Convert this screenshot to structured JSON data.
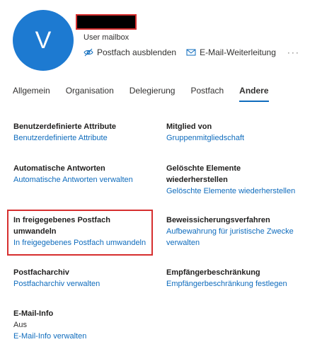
{
  "header": {
    "avatar_letter": "V",
    "subtitle": "User mailbox",
    "actions": [
      {
        "label": "Postfach ausblenden",
        "icon": "hide-mailbox-icon"
      },
      {
        "label": "E-Mail-Weiterleitung",
        "icon": "mail-forward-icon"
      }
    ],
    "more_label": "···"
  },
  "tabs": [
    {
      "label": "Allgemein",
      "active": false
    },
    {
      "label": "Organisation",
      "active": false
    },
    {
      "label": "Delegierung",
      "active": false
    },
    {
      "label": "Postfach",
      "active": false
    },
    {
      "label": "Andere",
      "active": true
    }
  ],
  "sections": {
    "custom_attributes": {
      "title": "Benutzerdefinierte Attribute",
      "link": "Benutzerdefinierte Attribute"
    },
    "member_of": {
      "title": "Mitglied von",
      "link": "Gruppenmitgliedschaft"
    },
    "auto_replies": {
      "title": "Automatische Antworten",
      "link": "Automatische Antworten verwalten"
    },
    "deleted_items": {
      "title_line1": "Gelöschte Elemente",
      "title_line2": "wiederherstellen",
      "link": "Gelöschte Elemente wiederherstellen"
    },
    "shared_mailbox": {
      "title_line1": "In freigegebenes Postfach",
      "title_line2": "umwandeln",
      "link": "In freigegebenes Postfach umwandeln"
    },
    "litigation_hold": {
      "title": "Beweissicherungsverfahren",
      "link_line1": "Aufbewahrung für juristische Zwecke",
      "link_line2": "verwalten"
    },
    "archive": {
      "title": "Postfacharchiv",
      "link": "Postfacharchiv verwalten"
    },
    "recipient_limits": {
      "title": "Empfängerbeschränkung",
      "link": "Empfängerbeschränkung festlegen"
    },
    "email_info": {
      "title": "E-Mail-Info",
      "value": "Aus",
      "link": "E-Mail-Info verwalten"
    }
  },
  "colors": {
    "accent": "#0f6cbd",
    "avatar": "#1d7ad1",
    "highlight": "#d62f2f"
  }
}
